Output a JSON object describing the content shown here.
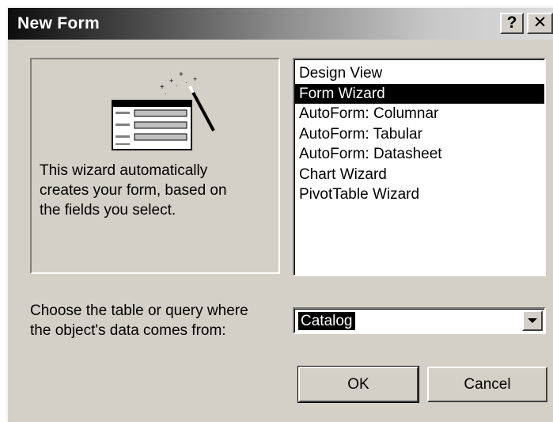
{
  "window": {
    "title": "New Form",
    "help_label": "?",
    "close_label": "✕"
  },
  "preview": {
    "icon": "form-wizard-icon",
    "description": "This wizard automatically\ncreates your form, based on\nthe fields you select."
  },
  "form_types": {
    "items": [
      {
        "label": "Design View"
      },
      {
        "label": "Form Wizard"
      },
      {
        "label": "AutoForm:  Columnar"
      },
      {
        "label": "AutoForm:  Tabular"
      },
      {
        "label": "AutoForm:  Datasheet"
      },
      {
        "label": "Chart Wizard"
      },
      {
        "label": "PivotTable Wizard"
      }
    ],
    "selected": "Form Wizard"
  },
  "source": {
    "label": "Choose the table or query where\nthe object's data comes from:",
    "value": "Catalog"
  },
  "buttons": {
    "ok": "OK",
    "cancel": "Cancel"
  },
  "colors": {
    "face": "#d4d0c8",
    "selection": "#000000"
  }
}
